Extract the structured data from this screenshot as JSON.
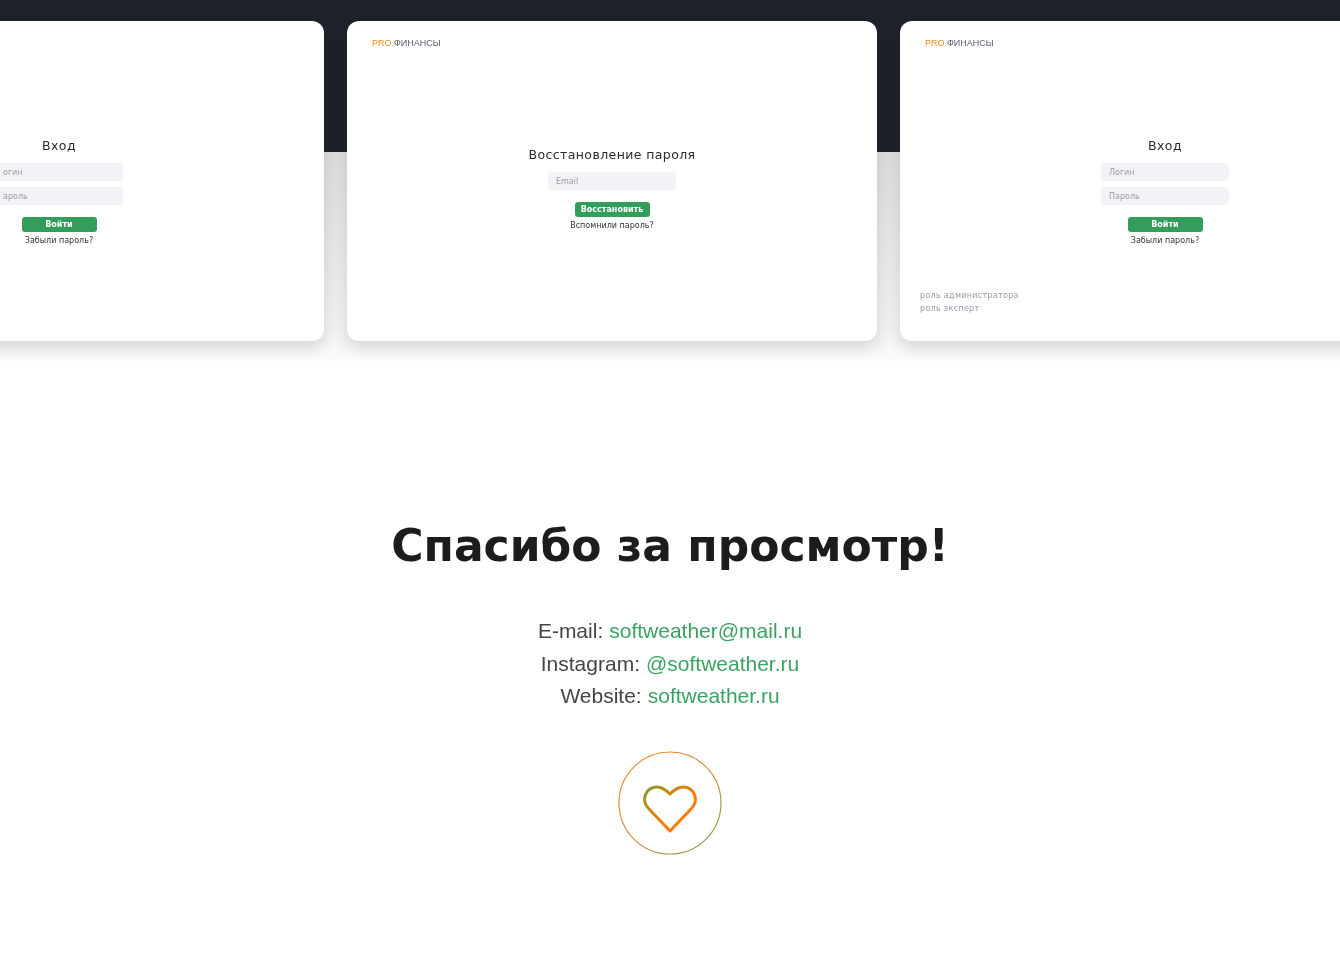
{
  "screens": [
    {
      "kind": "login",
      "title": "Вход",
      "fields": [
        {
          "placeholder": "огин"
        },
        {
          "placeholder": "ароль"
        }
      ],
      "button": "Войти",
      "link": "Забыли пароль?"
    },
    {
      "kind": "recovery",
      "logo": {
        "accent": "PRO.",
        "name": "ФИНАНСЫ"
      },
      "title": "Восстановление пароля",
      "fields": [
        {
          "placeholder": "Email"
        }
      ],
      "button": "Восстановить",
      "link": "Вспомнили пароль?"
    },
    {
      "kind": "login",
      "logo": {
        "accent": "PRO.",
        "name": "ФИНАНСЫ"
      },
      "title": "Вход",
      "fields": [
        {
          "placeholder": "Логин"
        },
        {
          "placeholder": "Пароль"
        }
      ],
      "button": "Войти",
      "link": "Забыли пароль?",
      "roles": [
        "роль администратора",
        "роль эксперт"
      ]
    }
  ],
  "heading": "Спасибо за просмотр!",
  "contacts": [
    {
      "label": "E-mail:",
      "value": "softweather@mail.ru"
    },
    {
      "label": "Instagram:",
      "value": "@softweather.ru"
    },
    {
      "label": "Website:",
      "value": "softweather.ru"
    }
  ]
}
